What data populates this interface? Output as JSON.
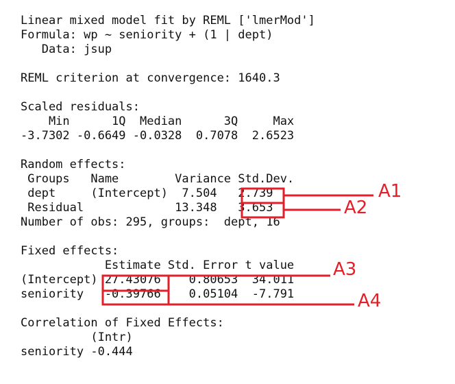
{
  "output": {
    "header": {
      "title": "Linear mixed model fit by REML ['lmerMod']",
      "formula": "Formula: wp ~ seniority + (1 | dept)",
      "data": "   Data: jsup"
    },
    "reml_criterion": "REML criterion at convergence: 1640.3",
    "scaled_residuals": {
      "heading": "Scaled residuals:",
      "labels": "    Min      1Q  Median      3Q     Max ",
      "values": "-3.7302 -0.6649 -0.0328  0.7078  2.6523 "
    },
    "random_effects": {
      "heading": "Random effects:",
      "header_row": " Groups   Name        Variance Std.Dev.",
      "rows": [
        " dept     (Intercept)  7.504   2.739   ",
        " Residual             13.348   3.653   "
      ],
      "nobs": "Number of obs: 295, groups:  dept, 16"
    },
    "fixed_effects": {
      "heading": "Fixed effects:",
      "header_row": "            Estimate Std. Error t value",
      "rows": [
        "(Intercept) 27.43076    0.80653  34.011",
        "seniority   -0.39766    0.05104  -7.791"
      ]
    },
    "correlation": {
      "heading": "Correlation of Fixed Effects:",
      "header_row": "          (Intr)",
      "row": "seniority -0.444"
    }
  },
  "annotations": {
    "color": "#e2202a",
    "labels": [
      "A1",
      "A2",
      "A3",
      "A4"
    ]
  }
}
